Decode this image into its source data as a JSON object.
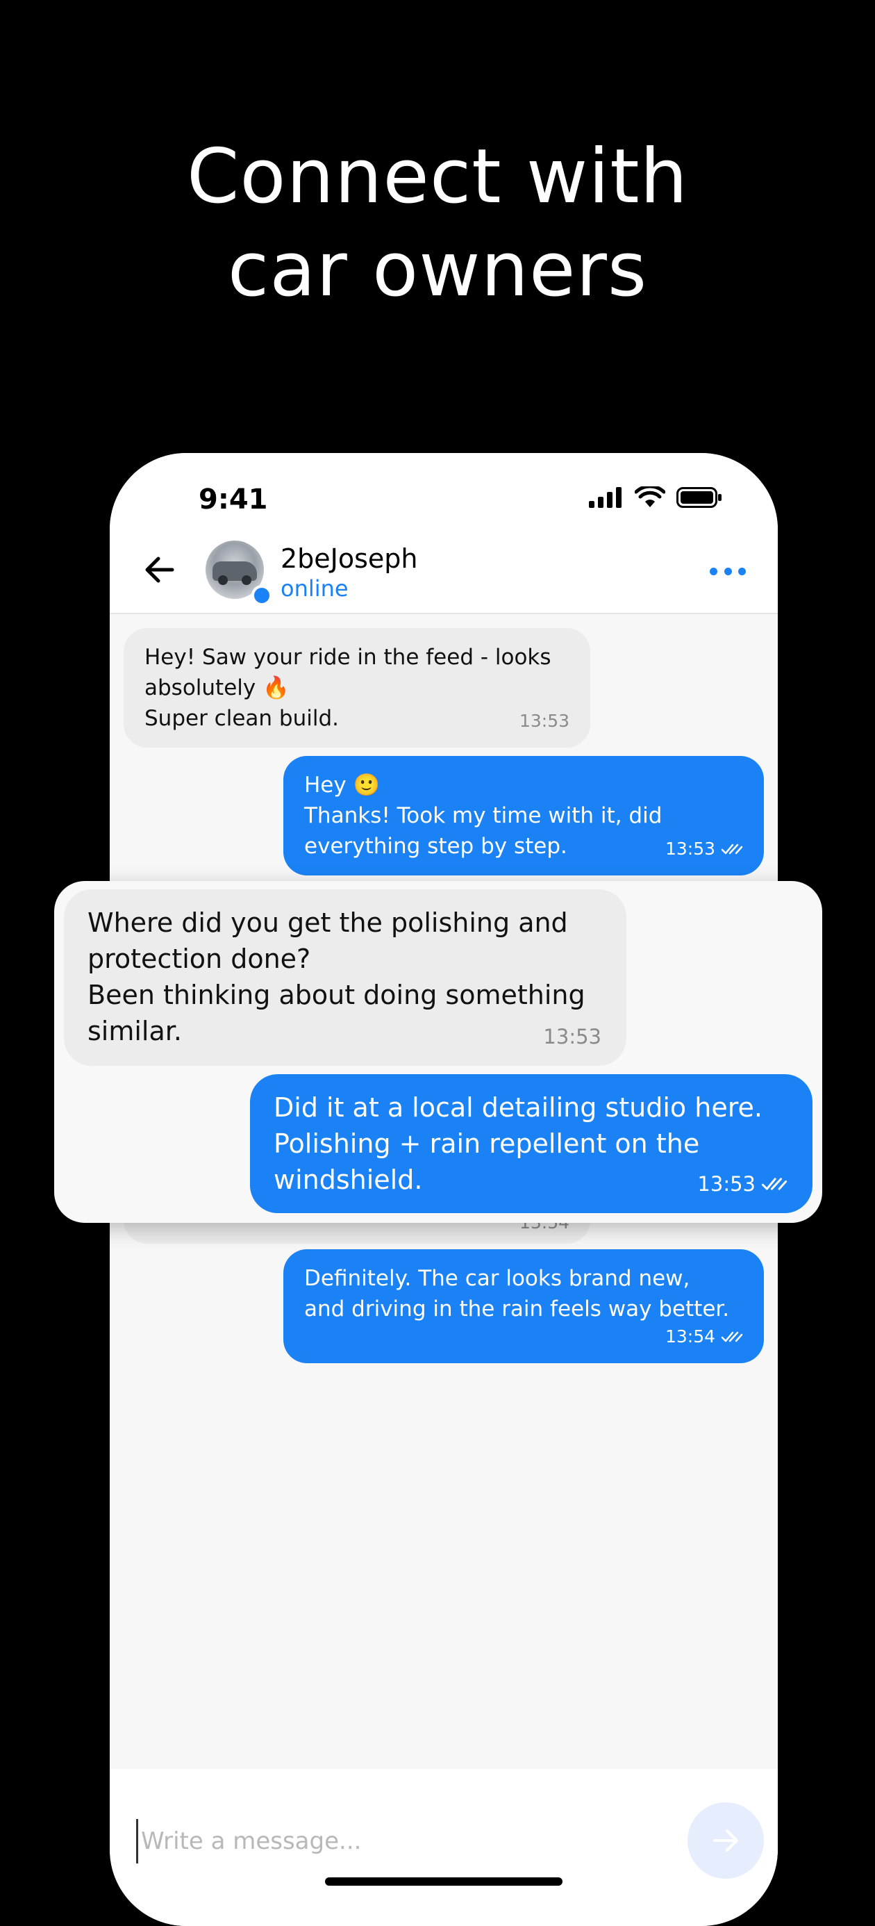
{
  "headline": {
    "line1": "Connect with",
    "line2": "car owners"
  },
  "status_bar": {
    "time": "9:41"
  },
  "chat_header": {
    "contact_name": "2beJoseph",
    "contact_status": "online"
  },
  "messages": [
    {
      "direction": "incoming",
      "lines": [
        "Hey! Saw your ride in the feed - looks",
        "absolutely 🔥",
        "Super clean build."
      ],
      "time": "13:53"
    },
    {
      "direction": "outgoing",
      "lines": [
        "Hey 🙂",
        "Thanks! Took my time with it, did",
        "everything step by step."
      ],
      "time": "13:53",
      "read": true
    },
    {
      "direction": "incoming",
      "lines": [],
      "time": "13:54"
    },
    {
      "direction": "outgoing",
      "lines": [
        "Definitely. The car looks brand new,",
        "and driving in the rain feels way better."
      ],
      "time": "13:54",
      "read": true
    }
  ],
  "highlight": {
    "incoming": {
      "lines": [
        "Where did you get the polishing and",
        "protection done?",
        "Been thinking about doing something",
        "similar."
      ],
      "time": "13:53"
    },
    "outgoing": {
      "lines": [
        "Did it at a local detailing studio here.",
        "Polishing + rain repellent on the",
        "windshield."
      ],
      "time": "13:53",
      "read": true
    }
  },
  "composer": {
    "placeholder": "Write a message..."
  },
  "colors": {
    "accent": "#1a82f5",
    "incoming_bubble": "#ececec",
    "background": "#000000"
  }
}
